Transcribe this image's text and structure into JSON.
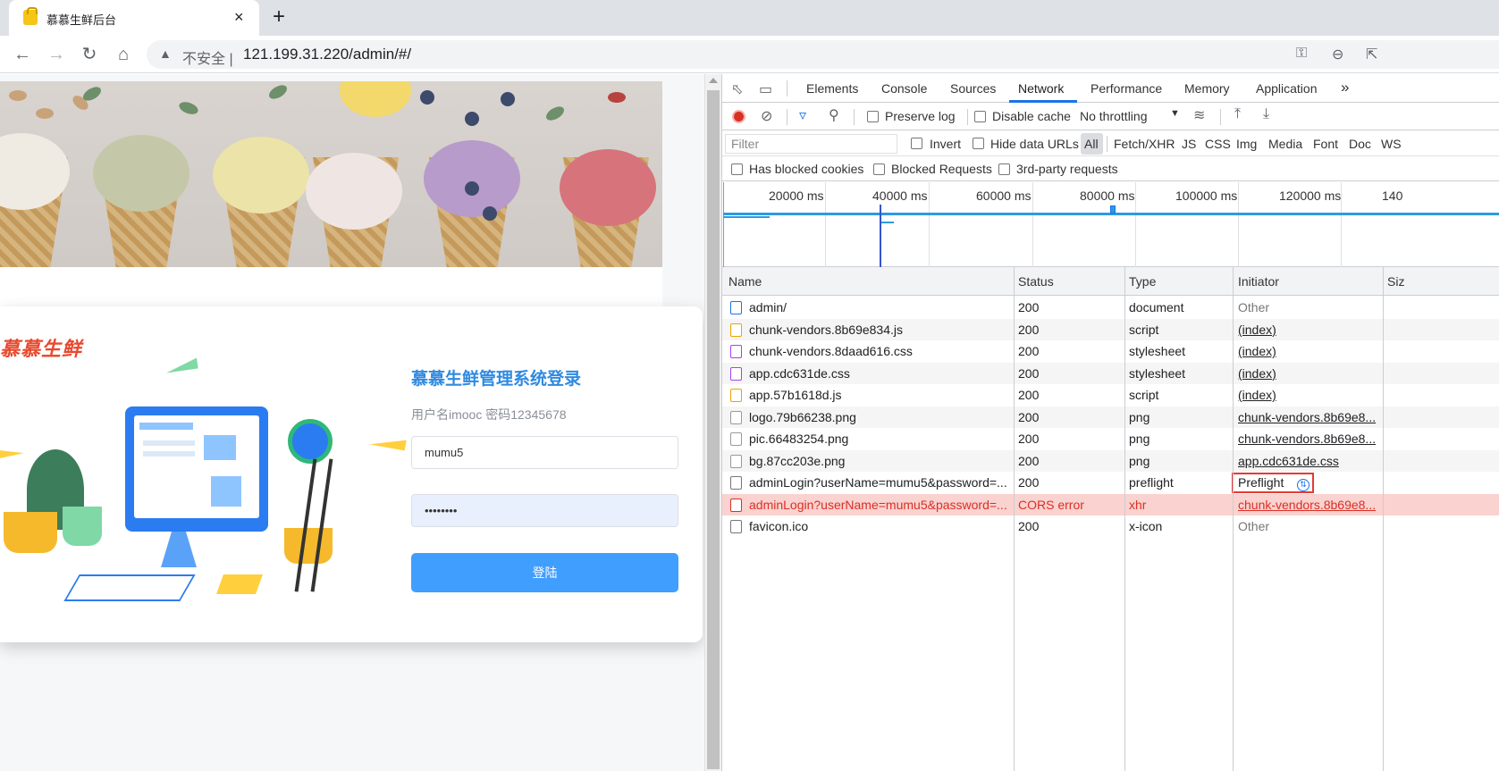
{
  "browser": {
    "tab_title": "慕慕生鲜后台",
    "new_tab": "+",
    "close": "×",
    "insecure_label": "不安全 |",
    "url": "121.199.31.220/admin/#/"
  },
  "page": {
    "brand": "慕慕生鲜",
    "login_title": "慕慕生鲜管理系统登录",
    "login_hint": "用户名imooc 密码12345678",
    "username_value": "mumu5",
    "password_value": "••••••••",
    "login_button": "登陆"
  },
  "devtools": {
    "tabs": [
      "Elements",
      "Console",
      "Sources",
      "Network",
      "Performance",
      "Memory",
      "Application"
    ],
    "active_tab": "Network",
    "more_tabs": "»",
    "controls": {
      "preserve_log": "Preserve log",
      "disable_cache": "Disable cache",
      "throttling": "No throttling"
    },
    "filter": {
      "placeholder": "Filter",
      "invert": "Invert",
      "hide_data_urls": "Hide data URLs",
      "types": [
        "All",
        "Fetch/XHR",
        "JS",
        "CSS",
        "Img",
        "Media",
        "Font",
        "Doc",
        "WS"
      ],
      "has_blocked_cookies": "Has blocked cookies",
      "blocked_requests": "Blocked Requests",
      "third_party": "3rd-party requests"
    },
    "timeline": {
      "labels": [
        "20000 ms",
        "40000 ms",
        "60000 ms",
        "80000 ms",
        "100000 ms",
        "120000 ms",
        "140"
      ]
    },
    "columns": [
      "Name",
      "Status",
      "Type",
      "Initiator",
      "Siz"
    ],
    "requests": [
      {
        "name": "admin/",
        "status": "200",
        "type": "document",
        "initiator": "Other",
        "icon": "doc"
      },
      {
        "name": "chunk-vendors.8b69e834.js",
        "status": "200",
        "type": "script",
        "initiator": "(index)",
        "icon": "js"
      },
      {
        "name": "chunk-vendors.8daad616.css",
        "status": "200",
        "type": "stylesheet",
        "initiator": "(index)",
        "icon": "css"
      },
      {
        "name": "app.cdc631de.css",
        "status": "200",
        "type": "stylesheet",
        "initiator": "(index)",
        "icon": "css"
      },
      {
        "name": "app.57b1618d.js",
        "status": "200",
        "type": "script",
        "initiator": "(index)",
        "icon": "js"
      },
      {
        "name": "logo.79b66238.png",
        "status": "200",
        "type": "png",
        "initiator": "chunk-vendors.8b69e8...",
        "icon": "img"
      },
      {
        "name": "pic.66483254.png",
        "status": "200",
        "type": "png",
        "initiator": "chunk-vendors.8b69e8...",
        "icon": "img"
      },
      {
        "name": "bg.87cc203e.png",
        "status": "200",
        "type": "png",
        "initiator": "app.cdc631de.css",
        "icon": "img"
      },
      {
        "name": "adminLogin?userName=mumu5&password=...",
        "status": "200",
        "type": "preflight",
        "initiator": "Preflight",
        "icon": "blank"
      },
      {
        "name": "adminLogin?userName=mumu5&password=...",
        "status": "CORS error",
        "type": "xhr",
        "initiator": "chunk-vendors.8b69e8...",
        "icon": "err"
      },
      {
        "name": "favicon.ico",
        "status": "200",
        "type": "x-icon",
        "initiator": "Other",
        "icon": "blank"
      }
    ]
  }
}
